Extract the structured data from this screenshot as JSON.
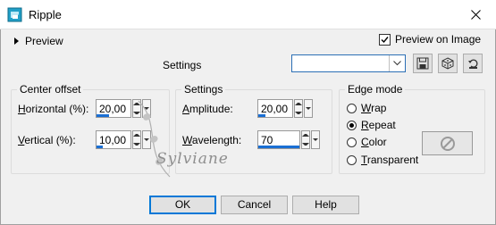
{
  "window": {
    "title": "Ripple",
    "close_icon": "close-icon"
  },
  "preview": {
    "label": "Preview",
    "preview_on_image": "Preview on Image"
  },
  "presets": {
    "label": "Settings",
    "selected": ""
  },
  "center_offset": {
    "title": "Center offset",
    "horizontal_label_u": "H",
    "horizontal_label_rest": "orizontal (%):",
    "horizontal_value": "20,00",
    "vertical_label_u": "V",
    "vertical_label_rest": "ertical (%):",
    "vertical_value": "10,00"
  },
  "settings": {
    "title": "Settings",
    "amplitude_label_u": "A",
    "amplitude_label_rest": "mplitude:",
    "amplitude_value": "20,00",
    "wavelength_label_u": "W",
    "wavelength_label_rest": "avelength:",
    "wavelength_value": "70"
  },
  "edge_mode": {
    "title": "Edge mode",
    "options": [
      {
        "label_u": "W",
        "label_rest": "rap",
        "checked": false
      },
      {
        "label_u": "R",
        "label_rest": "epeat",
        "checked": true
      },
      {
        "label_u": "C",
        "label_rest": "olor",
        "checked": false
      },
      {
        "label_u": "T",
        "label_rest": "ransparent",
        "checked": false
      }
    ]
  },
  "buttons": {
    "ok": "OK",
    "cancel": "Cancel",
    "help": "Help"
  },
  "watermark": {
    "text": "Sylviane"
  },
  "colors": {
    "accent": "#0078d7",
    "spin_bar": "#1a6fd4"
  }
}
